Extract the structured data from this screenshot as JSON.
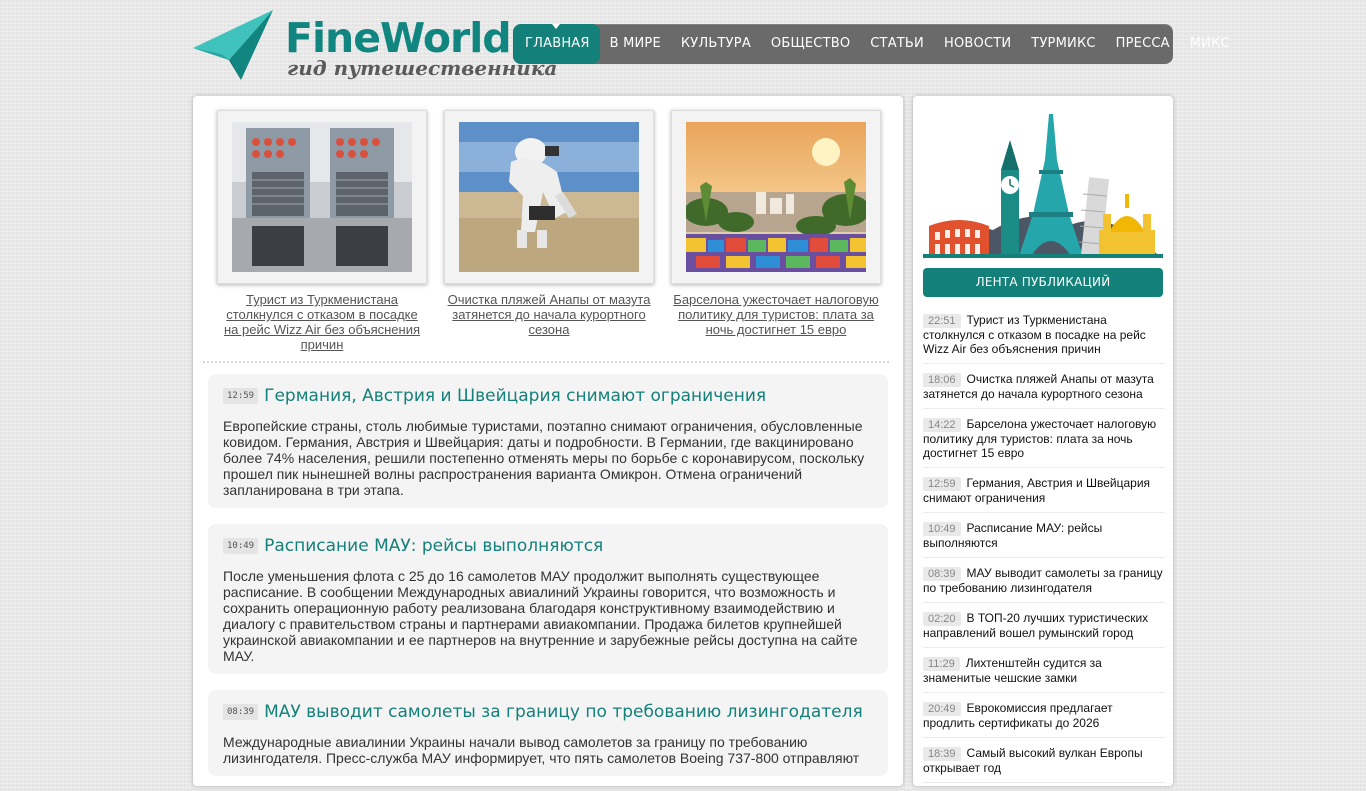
{
  "logo": {
    "title": "FineWorld",
    "subtitle": "гид путешественника"
  },
  "nav": [
    {
      "label": "ГЛАВНАЯ",
      "active": true
    },
    {
      "label": "В МИРЕ"
    },
    {
      "label": "КУЛЬТУРА"
    },
    {
      "label": "ОБЩЕСТВО"
    },
    {
      "label": "СТАТЬИ"
    },
    {
      "label": "НОВОСТИ"
    },
    {
      "label": "ТУРМИКС"
    },
    {
      "label": "ПРЕССА"
    },
    {
      "label": "МИКС"
    }
  ],
  "featured": [
    {
      "caption": "Турист из Туркменистана столкнулся с отказом в посадке на рейс Wizz Air без объяснения причин"
    },
    {
      "caption": "Очистка пляжей Анапы от мазута затянется до начала курортного сезона"
    },
    {
      "caption": "Барселона ужесточает налоговую политику для туристов: плата за ночь достигнет 15 евро"
    }
  ],
  "articles": [
    {
      "time": "12:59",
      "title": "Германия, Австрия и Швейцария снимают ограничения",
      "body": "Европейские страны, столь любимые туристами, поэтапно снимают ограничения, обусловленные ковидом. Германия, Австрия и Швейцария: даты и подробности. В Германии, где вакцинировано более 74% населения, решили постепенно отменять меры по борьбе с коронавирусом, поскольку прошел пик нынешней волны распространения варианта Омикрон. Отмена ограничений запланирована в три этапа."
    },
    {
      "time": "10:49",
      "title": "Расписание МАУ: рейсы выполняются",
      "body": "После уменьшения флота с 25 до 16 самолетов МАУ продолжит выполнять существующее расписание. В сообщении Международных авиалиний Украины говорится, что возможность и сохранить операционную работу реализована благодаря конструктивному взаимодействию и диалогу с правительством страны и партнерами авиакомпании. Продажа билетов крупнейшей украинской авиакомпании и ее партнеров на внутренние и зарубежные рейсы доступна на сайте МАУ."
    },
    {
      "time": "08:39",
      "title": "МАУ выводит самолеты за границу по требованию лизингодателя",
      "body": "Международные авиалинии Украины начали вывод самолетов за границу по требованию лизингодателя. Пресс-служба МАУ информирует, что пять самолетов Boeing 737-800 отправляют"
    }
  ],
  "sidebar": {
    "feed_title": "ЛЕНТА ПУБЛИКАЦИЙ",
    "feed": [
      {
        "time": "22:51",
        "text": "Турист из Туркменистана столкнулся с отказом в посадке на рейс Wizz Air без объяснения причин"
      },
      {
        "time": "18:06",
        "text": "Очистка пляжей Анапы от мазута затянется до начала курортного сезона"
      },
      {
        "time": "14:22",
        "text": "Барселона ужесточает налоговую политику для туристов: плата за ночь достигнет 15 евро"
      },
      {
        "time": "12:59",
        "text": "Германия, Австрия и Швейцария снимают ограничения"
      },
      {
        "time": "10:49",
        "text": "Расписание МАУ: рейсы выполняются"
      },
      {
        "time": "08:39",
        "text": "МАУ выводит самолеты за границу по требованию лизингодателя"
      },
      {
        "time": "02:20",
        "text": "В ТОП-20 лучших туристических направлений вошел румынский город"
      },
      {
        "time": "11:29",
        "text": "Лихтенштейн судится за знаменитые чешские замки"
      },
      {
        "time": "20:49",
        "text": "Еврокомиссия предлагает продлить сертификаты до 2026"
      },
      {
        "time": "18:39",
        "text": "Самый высокий вулкан Европы открывает год"
      }
    ]
  },
  "colors": {
    "accent": "#13807a",
    "nav_bg": "#6a6a6a"
  }
}
